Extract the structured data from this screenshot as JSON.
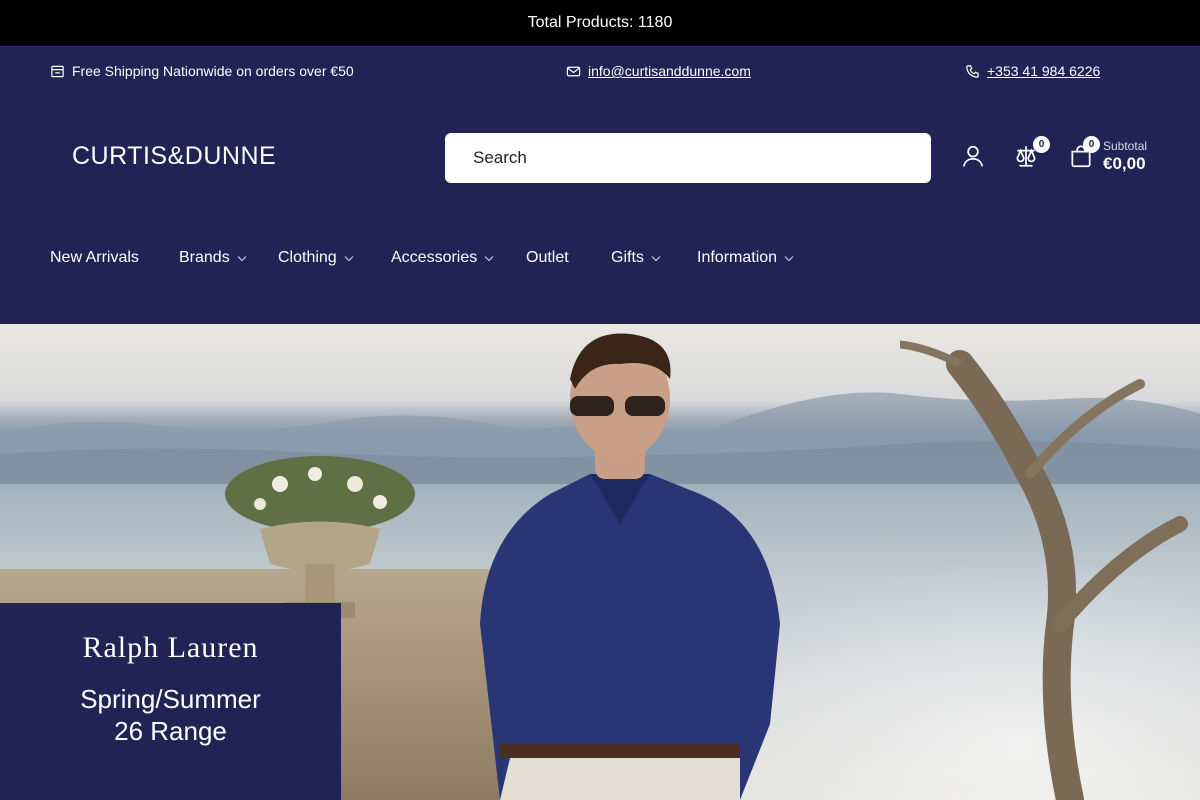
{
  "announcement": {
    "text": "Total Products: 1180"
  },
  "infobar": {
    "shipping": "Free Shipping Nationwide on orders over €50",
    "email": "info@curtisanddunne.com",
    "phone": "+353 41 984 6226"
  },
  "header": {
    "logo": "CURTIS&DUNNE",
    "search_placeholder": "Search",
    "compare_count": "0",
    "cart_count": "0",
    "subtotal_label": "Subtotal",
    "subtotal_amount": "€0,00"
  },
  "nav": {
    "items": [
      {
        "label": "New Arrivals",
        "dropdown": false
      },
      {
        "label": "Brands",
        "dropdown": true
      },
      {
        "label": "Clothing",
        "dropdown": true
      },
      {
        "label": "Accessories",
        "dropdown": true
      },
      {
        "label": "Outlet",
        "dropdown": false
      },
      {
        "label": "Gifts",
        "dropdown": true
      },
      {
        "label": "Information",
        "dropdown": true
      }
    ]
  },
  "hero": {
    "brand": "Ralph Lauren",
    "line1": "Spring/Summer",
    "line2": "26 Range"
  },
  "colors": {
    "brand_navy": "#202353",
    "topbar": "#000000"
  }
}
